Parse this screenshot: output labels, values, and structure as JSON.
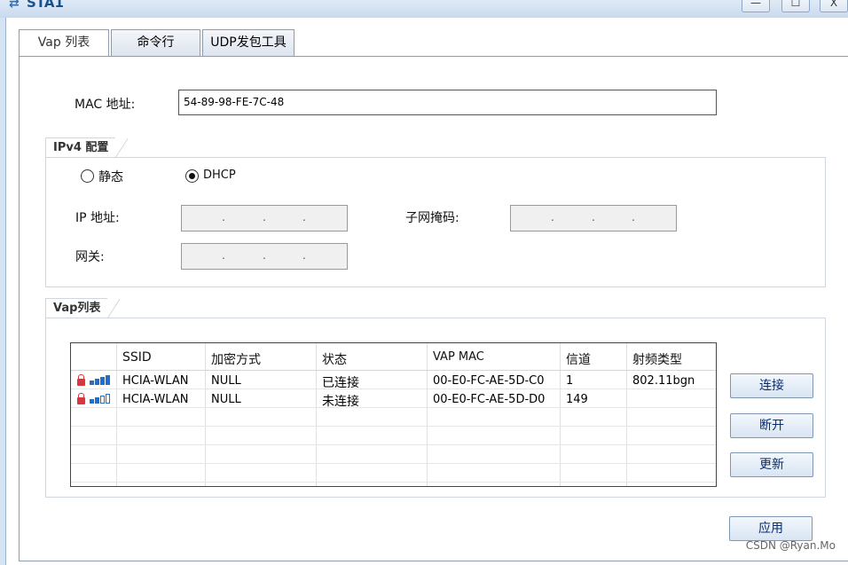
{
  "window": {
    "title": "STA1",
    "controls": [
      "—",
      "☐",
      "X"
    ]
  },
  "tabs": [
    {
      "label": "Vap 列表"
    },
    {
      "label": "命令行"
    },
    {
      "label": "UDP发包工具"
    }
  ],
  "mac": {
    "label": "MAC 地址:",
    "value": "54-89-98-FE-7C-48"
  },
  "ipv4": {
    "group_title": "IPv4 配置",
    "static_label": "静态",
    "dhcp_label": "DHCP",
    "ip_label": "IP 地址:",
    "mask_label": "子网掩码:",
    "gateway_label": "网关:",
    "ip_dots": [
      ".",
      ".",
      "."
    ]
  },
  "vap": {
    "group_title": "Vap列表",
    "columns": [
      "SSID",
      "加密方式",
      "状态",
      "VAP MAC",
      "信道",
      "射频类型"
    ],
    "rows": [
      {
        "ssid": "HCIA-WLAN",
        "encryption": "NULL",
        "status": "已连接",
        "vap_mac": "00-E0-FC-AE-5D-C0",
        "channel": "1",
        "radio": "802.11bgn",
        "signal_bars": 4
      },
      {
        "ssid": "HCIA-WLAN",
        "encryption": "NULL",
        "status": "未连接",
        "vap_mac": "00-E0-FC-AE-5D-D0",
        "channel": "149",
        "radio": "",
        "signal_bars": 2
      }
    ]
  },
  "buttons": {
    "connect": "连接",
    "disconnect": "断开",
    "refresh": "更新",
    "apply": "应用"
  },
  "watermark": "CSDN @Ryan.Mo",
  "colors": {
    "accent": "#1f6fd1",
    "lock": "#d9363e",
    "window_bg": "#d5e3f2"
  }
}
